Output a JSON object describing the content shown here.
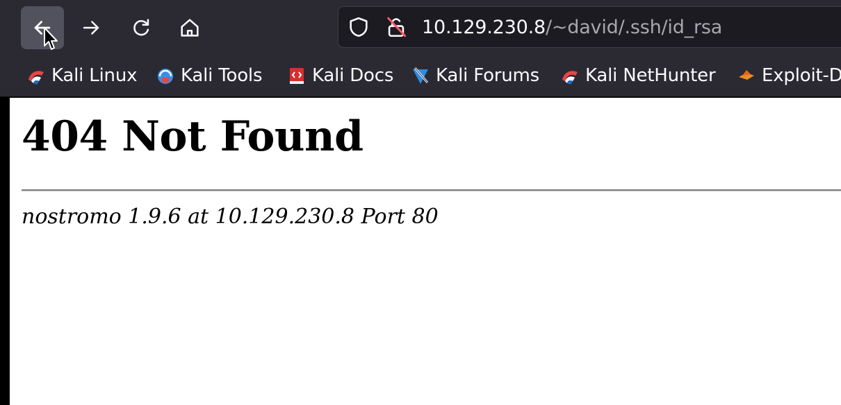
{
  "toolbar": {
    "back_icon": "back-arrow-icon",
    "forward_icon": "forward-arrow-icon",
    "reload_icon": "reload-icon",
    "home_icon": "home-icon"
  },
  "urlbar": {
    "host": "10.129.230.8",
    "path": "/~david/.ssh/id_rsa",
    "tracking_icon": "shield-icon",
    "security_icon": "insecure-lock-icon"
  },
  "bookmarks": [
    {
      "label": "Kali Linux",
      "icon": "kali-dragon-icon"
    },
    {
      "label": "Kali Tools",
      "icon": "kali-tools-icon"
    },
    {
      "label": "Kali Docs",
      "icon": "kali-docs-icon"
    },
    {
      "label": "Kali Forums",
      "icon": "kali-forums-icon"
    },
    {
      "label": "Kali NetHunter",
      "icon": "kali-dragon-icon"
    },
    {
      "label": "Exploit-D",
      "icon": "exploit-db-icon"
    }
  ],
  "page": {
    "title": "404 Not Found",
    "signature": "nostromo 1.9.6 at 10.129.230.8 Port 80"
  },
  "colors": {
    "chrome_bg": "#2b2a33",
    "urlbar_bg": "#1c1b22",
    "text_light": "#fbfbfe",
    "url_path": "#a8a7ae",
    "page_bg": "#ffffff"
  }
}
